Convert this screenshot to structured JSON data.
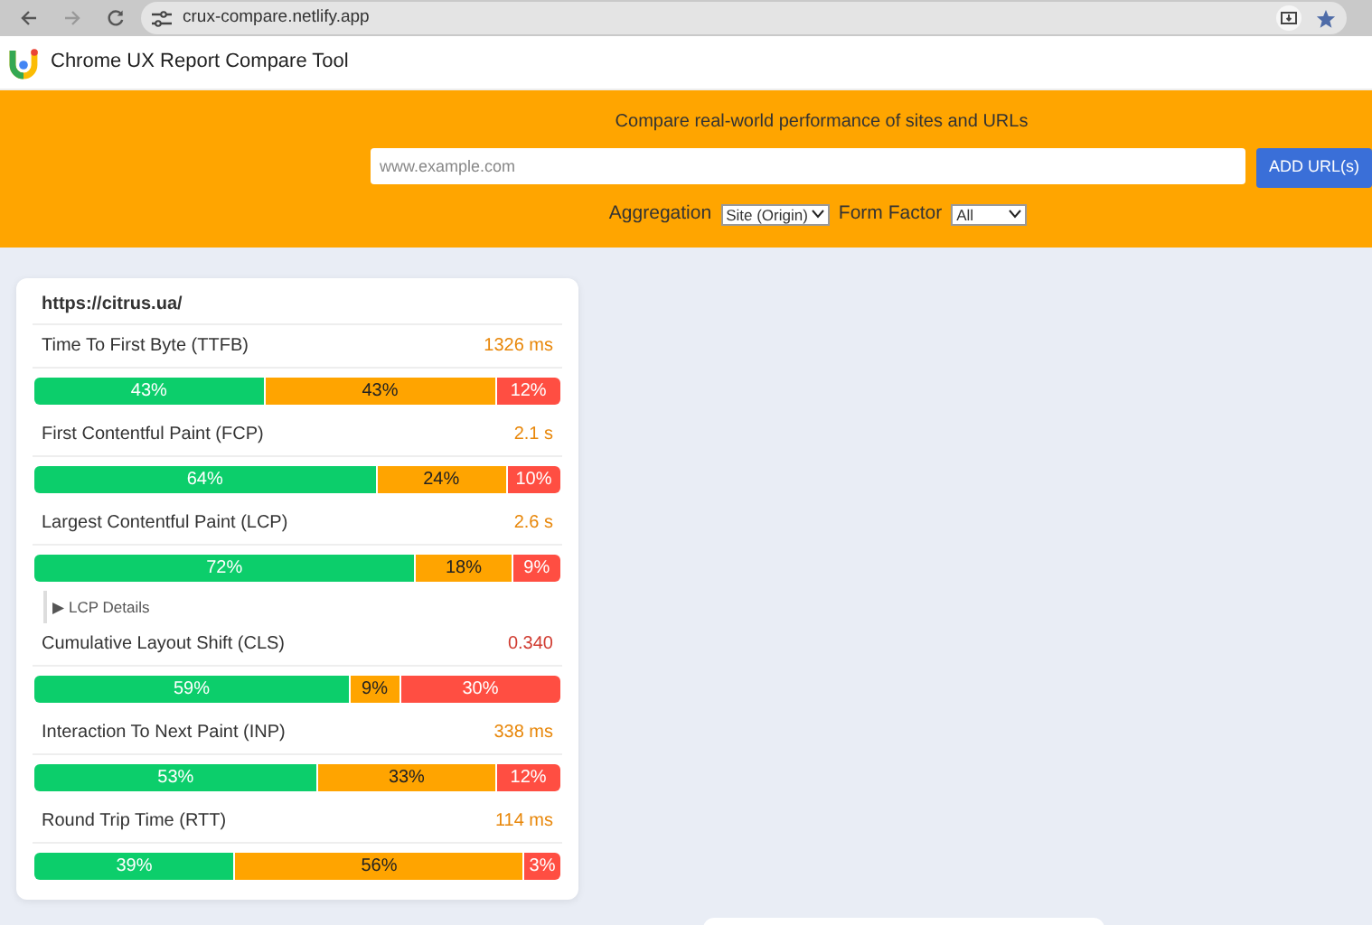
{
  "browser": {
    "url": "crux-compare.netlify.app"
  },
  "app": {
    "title": "Chrome UX Report Compare Tool"
  },
  "hero": {
    "tagline": "Compare real-world performance of sites and URLs",
    "url_field": {
      "placeholder": "www.example.com"
    },
    "add_button": "ADD URL(s)",
    "aggregation": {
      "label": "Aggregation",
      "value": "Site (Origin)"
    },
    "form_factor": {
      "label": "Form Factor",
      "value": "All"
    }
  },
  "report": {
    "url": "https://citrus.ua/",
    "metrics": [
      {
        "name": "Time To First Byte (TTFB)",
        "value": "1326 ms",
        "color": "#e8870a",
        "segments": [
          {
            "kind": "good",
            "label": "43%"
          },
          {
            "kind": "needs-improvement",
            "label": "43%"
          },
          {
            "kind": "poor",
            "label": "12%"
          }
        ]
      },
      {
        "name": "First Contentful Paint (FCP)",
        "value": "2.1 s",
        "color": "#e8870a",
        "segments": [
          {
            "kind": "good",
            "label": "64%"
          },
          {
            "kind": "needs-improvement",
            "label": "24%"
          },
          {
            "kind": "poor",
            "label": "10%"
          }
        ]
      },
      {
        "name": "Largest Contentful Paint (LCP)",
        "value": "2.6 s",
        "color": "#e8870a",
        "segments": [
          {
            "kind": "good",
            "label": "72%"
          },
          {
            "kind": "needs-improvement",
            "label": "18%"
          },
          {
            "kind": "poor",
            "label": "9%"
          }
        ],
        "details": {
          "marker": "▶",
          "label": "LCP Details",
          "expanded": false
        }
      },
      {
        "name": "Cumulative Layout Shift (CLS)",
        "value": "0.340",
        "color": "#d03b30",
        "segments": [
          {
            "kind": "good",
            "label": "59%"
          },
          {
            "kind": "needs-improvement",
            "label": "9%"
          },
          {
            "kind": "poor",
            "label": "30%"
          }
        ]
      },
      {
        "name": "Interaction To Next Paint (INP)",
        "value": "338 ms",
        "color": "#e8870a",
        "segments": [
          {
            "kind": "good",
            "label": "53%"
          },
          {
            "kind": "needs-improvement",
            "label": "33%"
          },
          {
            "kind": "poor",
            "label": "12%"
          }
        ]
      },
      {
        "name": "Round Trip Time (RTT)",
        "value": "114 ms",
        "color": "#e8870a",
        "segments": [
          {
            "kind": "good",
            "label": "39%"
          },
          {
            "kind": "needs-improvement",
            "label": "56%"
          },
          {
            "kind": "poor",
            "label": "3%"
          }
        ]
      }
    ]
  }
}
